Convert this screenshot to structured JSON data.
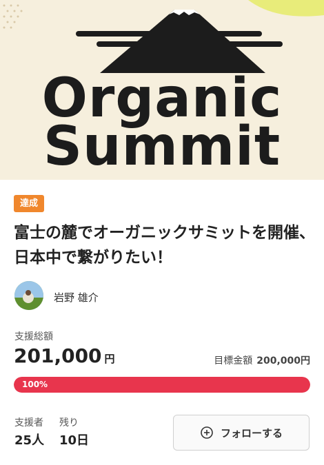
{
  "hero": {
    "logo_line1": "Organic",
    "logo_line2": "Summit"
  },
  "project": {
    "status_badge": "達成",
    "title": "富士の麓でオーガニックサミットを開催、日本中で繋がりたい！",
    "owner_name": "岩野 雄介"
  },
  "funding": {
    "total_label": "支援総額",
    "total_amount": "201,000",
    "currency_unit": "円",
    "goal_label": "目標金額",
    "goal_amount": "200,000円",
    "progress_percent": 100,
    "progress_text": "100%"
  },
  "stats": {
    "supporters_label": "支援者",
    "supporters_value": "25人",
    "remaining_label": "残り",
    "remaining_value": "10日"
  },
  "actions": {
    "follow_label": "フォローする",
    "follow_icon": "plus-circle-icon"
  },
  "colors": {
    "badge": "#f0872d",
    "progress": "#e8354d",
    "hero_bg": "#f6efdd"
  }
}
